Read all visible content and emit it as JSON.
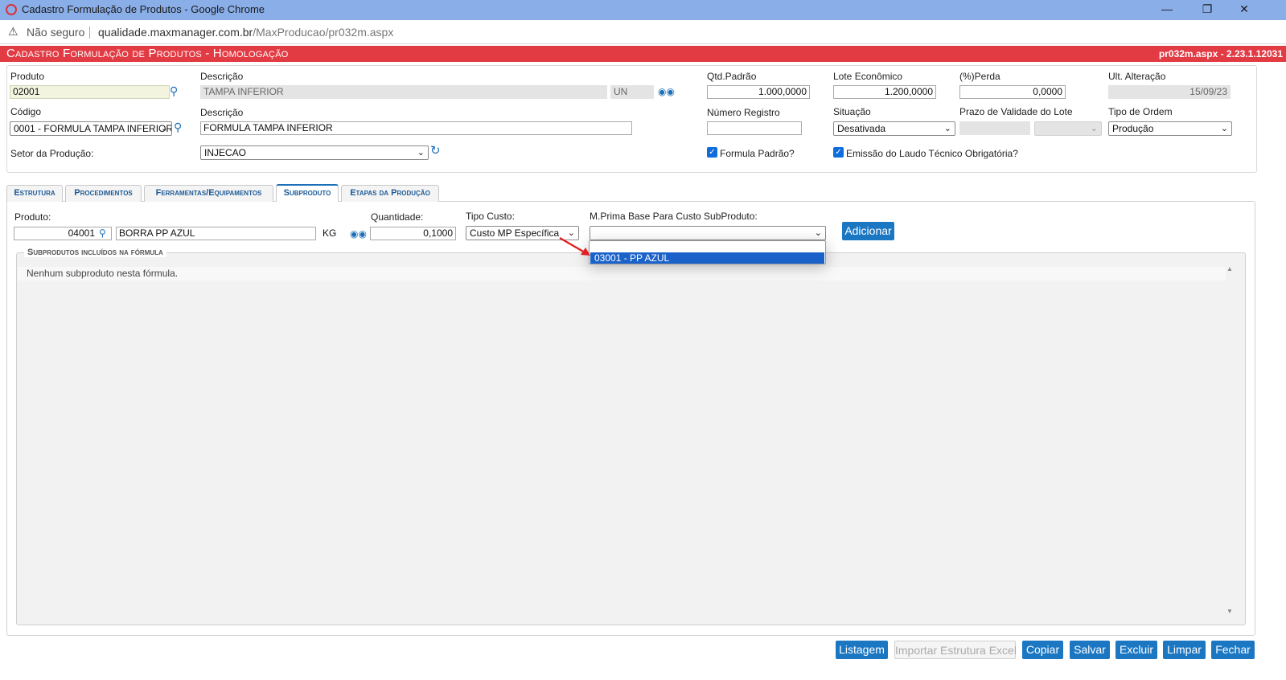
{
  "window": {
    "title": "Cadastro Formulação de Produtos - Google Chrome",
    "minimize": "—",
    "restore": "❐",
    "close": "✕"
  },
  "address_bar": {
    "security_label": "Não seguro",
    "host": "qualidade.maxmanager.com.br",
    "path": "/MaxProducao/pr032m.aspx"
  },
  "header": {
    "title": "Cadastro Formulação de Produtos  - Homologação",
    "version": "pr032m.aspx - 2.23.1.12031",
    "color": "#e23b44"
  },
  "form": {
    "produto_label": "Produto",
    "produto_value": "02001",
    "descricao_label": "Descrição",
    "descricao_value": "TAMPA INFERIOR",
    "unidade_value": "UN",
    "qtd_padrao_label": "Qtd.Padrão",
    "qtd_padrao_value": "1.000,0000",
    "lote_economico_label": "Lote Econômico",
    "lote_economico_value": "1.200,0000",
    "perda_label": "(%)Perda",
    "perda_value": "0,0000",
    "ult_alteracao_label": "Ult. Alteração",
    "ult_alteracao_value": "15/09/23",
    "codigo_label": "Código",
    "codigo_value": "0001 - FORMULA TAMPA INFERIOR",
    "descricao2_label": "Descrição",
    "descricao2_value": "FORMULA TAMPA INFERIOR",
    "numero_registro_label": "Número Registro",
    "numero_registro_value": "",
    "situacao_label": "Situação",
    "situacao_value": "Desativada",
    "prazo_validade_label": "Prazo de Validade do Lote",
    "tipo_ordem_label": "Tipo de Ordem",
    "tipo_ordem_value": "Produção",
    "setor_label": "Setor da Produção:",
    "setor_value": "INJECAO",
    "formula_padrao_label": "Formula Padrão?",
    "formula_padrao_checked": true,
    "emissao_laudo_label": "Emissão do Laudo Técnico Obrigatória?",
    "emissao_laudo_checked": true
  },
  "tabs": [
    {
      "label": "Estrutura",
      "active": false
    },
    {
      "label": "Procedimentos",
      "active": false
    },
    {
      "label": "Ferramentas/Equipamentos",
      "active": false
    },
    {
      "label": "Subproduto",
      "active": true
    },
    {
      "label": "Etapas da Produção",
      "active": false
    }
  ],
  "subproduto": {
    "produto_label": "Produto:",
    "produto_value": "04001",
    "descricao_value": "BORRA PP AZUL",
    "unidade_value": "KG",
    "quantidade_label": "Quantidade:",
    "quantidade_value": "0,1000",
    "tipo_custo_label": "Tipo Custo:",
    "tipo_custo_value": "Custo MP Específica",
    "mprima_label": "M.Prima Base Para Custo SubProduto:",
    "mprima_value": "",
    "mprima_options": [
      "",
      "03001 - PP AZUL"
    ],
    "mprima_highlighted": "03001 - PP AZUL",
    "adicionar_label": "Adicionar",
    "list_title": "Subprodutos incluídos na fórmula",
    "empty_text": "Nenhum subproduto nesta fórmula."
  },
  "footer_buttons": {
    "listagem": "Listagem",
    "importar": "Importar Estrutura Excel",
    "copiar": "Copiar",
    "salvar": "Salvar",
    "excluir": "Excluir",
    "limpar": "Limpar",
    "fechar": "Fechar"
  },
  "colors": {
    "accent": "#1c77c3",
    "dropdown_highlight": "#1a62c9",
    "annotation_arrow": "#e02020"
  }
}
